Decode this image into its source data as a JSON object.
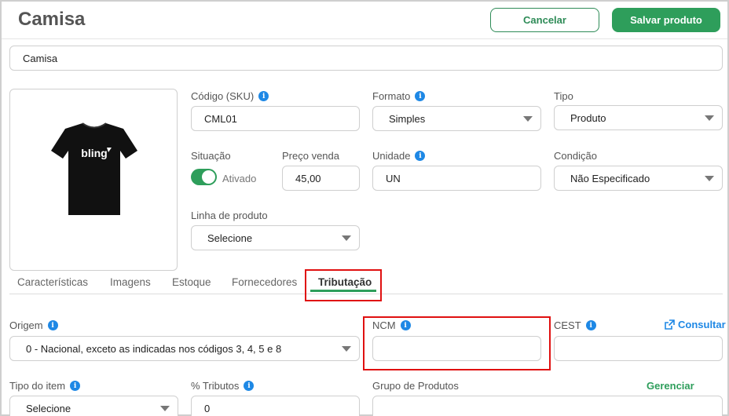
{
  "header": {
    "title": "Camisa",
    "cancel_label": "Cancelar",
    "save_label": "Salvar produto"
  },
  "product_name": "Camisa",
  "image": {
    "logo_text": "bling"
  },
  "fields": {
    "sku": {
      "label": "Código (SKU)",
      "value": "CML01"
    },
    "formato": {
      "label": "Formato",
      "value": "Simples"
    },
    "tipo": {
      "label": "Tipo",
      "value": "Produto"
    },
    "situacao": {
      "label": "Situação",
      "state": "Ativado"
    },
    "preco": {
      "label": "Preço venda",
      "value": "45,00"
    },
    "unidade": {
      "label": "Unidade",
      "value": "UN"
    },
    "condicao": {
      "label": "Condição",
      "value": "Não Especificado"
    },
    "linha": {
      "label": "Linha de produto",
      "value": "Selecione"
    }
  },
  "tabs": [
    {
      "label": "Características"
    },
    {
      "label": "Imagens"
    },
    {
      "label": "Estoque"
    },
    {
      "label": "Fornecedores"
    },
    {
      "label": "Tributação",
      "active": true
    }
  ],
  "tributacao": {
    "origem": {
      "label": "Origem",
      "value": "0 - Nacional, exceto as indicadas nos códigos 3, 4, 5 e 8"
    },
    "ncm": {
      "label": "NCM",
      "value": ""
    },
    "cest": {
      "label": "CEST",
      "value": ""
    },
    "consultar_label": "Consultar",
    "tipo_item": {
      "label": "Tipo do item",
      "value": "Selecione"
    },
    "tributos": {
      "label": "% Tributos",
      "value": "0"
    },
    "grupo": {
      "label": "Grupo de Produtos",
      "value": ""
    },
    "gerenciar_label": "Gerenciar grupos"
  },
  "colors": {
    "accent_green": "#2e9e5b",
    "info_blue": "#1e88e5",
    "highlight_red": "#e01010",
    "link_blue": "#1e88e5"
  },
  "icons": {
    "info": "info-icon",
    "external_link": "external-link-icon",
    "caret": "chevron-down-icon"
  }
}
